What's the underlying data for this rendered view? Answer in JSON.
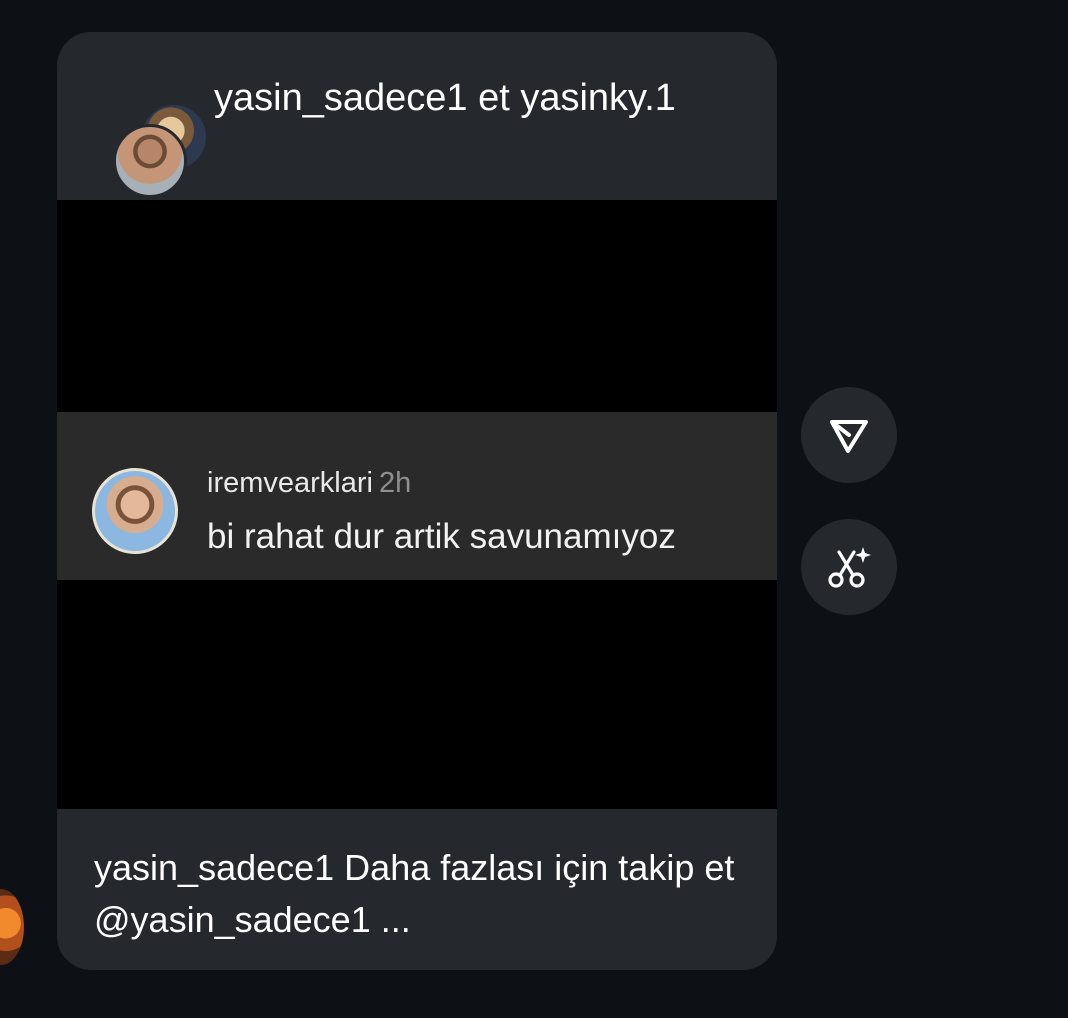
{
  "post": {
    "header": {
      "title": "yasin_sadece1 et yasinky.1",
      "avatars": [
        "anime-avatar",
        "man-avatar"
      ]
    },
    "comment": {
      "username": "iremvearklari",
      "time": "2h",
      "text": "bi rahat dur artik savunamıyoz"
    },
    "caption": "yasin_sadece1 Daha fazlası için takip et @yasin_sadece1 ..."
  },
  "actions": {
    "share_icon": "send-icon",
    "clip_icon": "scissors-sparkle-icon"
  },
  "colors": {
    "background": "#0d1116",
    "card": "#25292e",
    "video": "#000000",
    "comment_strip": "#2a2a2a",
    "text": "#ffffff",
    "muted": "#8f8f8f"
  }
}
